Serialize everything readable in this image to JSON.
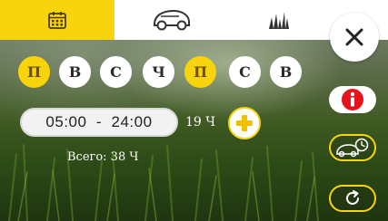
{
  "tabs": [
    {
      "name": "schedule",
      "icon": "calendar-icon",
      "active": true
    },
    {
      "name": "mower",
      "icon": "robot-mower-icon",
      "active": false
    },
    {
      "name": "grass",
      "icon": "grass-icon",
      "active": false
    }
  ],
  "close": {
    "icon": "close-icon"
  },
  "days": [
    {
      "label": "П",
      "active": true
    },
    {
      "label": "В",
      "active": false
    },
    {
      "label": "С",
      "active": false
    },
    {
      "label": "Ч",
      "active": false
    },
    {
      "label": "П",
      "active": true
    },
    {
      "label": "С",
      "active": false
    },
    {
      "label": "В",
      "active": false
    }
  ],
  "schedule": {
    "time_range": "05:00  -  24:00",
    "duration": "19 Ч",
    "total": "Всего: 38 Ч"
  },
  "side_buttons": {
    "info_icon": "info-icon",
    "mower_schedule_icon": "mower-clock-icon",
    "reset_icon": "refresh-icon"
  },
  "colors": {
    "accent": "#f7d40c",
    "info_red": "#e8121c",
    "bar": "#ffffff"
  }
}
